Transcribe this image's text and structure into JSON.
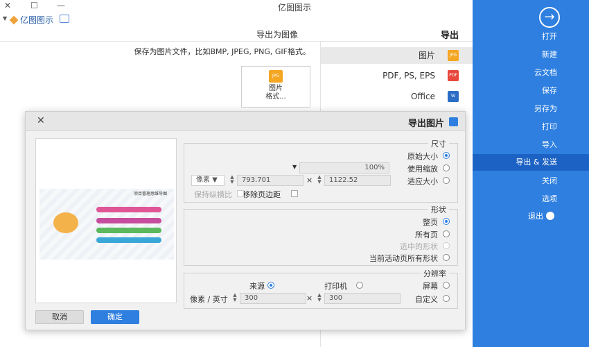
{
  "window": {
    "title": "亿图图示",
    "minimize": "—",
    "restore": "☐",
    "close": "✕"
  },
  "quick_access": {
    "brand": "亿图图示",
    "menu_arrow": "▼"
  },
  "sidebar": {
    "accent_color": "#2e7fe0",
    "back_glyph": "→",
    "items": [
      {
        "label": "打开"
      },
      {
        "label": "新建"
      },
      {
        "label": "云文档"
      },
      {
        "label": "保存"
      },
      {
        "label": "另存为"
      },
      {
        "label": "打印"
      },
      {
        "label": "导入"
      },
      {
        "label": "导出 & 发送",
        "active": true
      },
      {
        "label": "关闭"
      },
      {
        "label": "选项"
      },
      {
        "label": "退出"
      }
    ]
  },
  "export": {
    "heading": "导出",
    "subheading": "导出为图像",
    "formats": [
      {
        "label": "图片",
        "icon": "jpg-icon",
        "badge": "JPG",
        "active": true
      },
      {
        "label": "PDF, PS, EPS",
        "icon": "pdf-icon",
        "badge": "PDF"
      },
      {
        "label": "Office",
        "icon": "word-icon",
        "badge": "W"
      }
    ],
    "description": "保存为图片文件，比如BMP, JPEG, PNG, GIF格式。",
    "card": {
      "line1": "图片",
      "line2": "格式..."
    }
  },
  "dialog": {
    "title": "导出图片",
    "close_glyph": "✕",
    "preview": {
      "diagram_title": "项目管理思维导图"
    },
    "size": {
      "label": "尺寸",
      "original": "原始大小",
      "zoom": "使用缩放",
      "zoom_value": "100%",
      "fit": "适应大小",
      "width": "1122.52",
      "times": "×",
      "height": "793.701",
      "unit": "像素",
      "remove_margin": "移除页边距",
      "keep_ratio": "保持纵横比"
    },
    "shape": {
      "label": "形状",
      "current_page": "整页",
      "all_pages": "所有页",
      "selected_shapes": "选中的形状",
      "all_current_shapes": "当前活动页所有形状"
    },
    "resolution": {
      "label": "分辨率",
      "screen": "屏幕",
      "printer": "打印机",
      "source": "来源",
      "custom": "自定义",
      "dpi_x": "300",
      "times": "×",
      "dpi_y": "300",
      "unit": "像素 / 英寸"
    },
    "ok": "确定",
    "cancel": "取消"
  }
}
